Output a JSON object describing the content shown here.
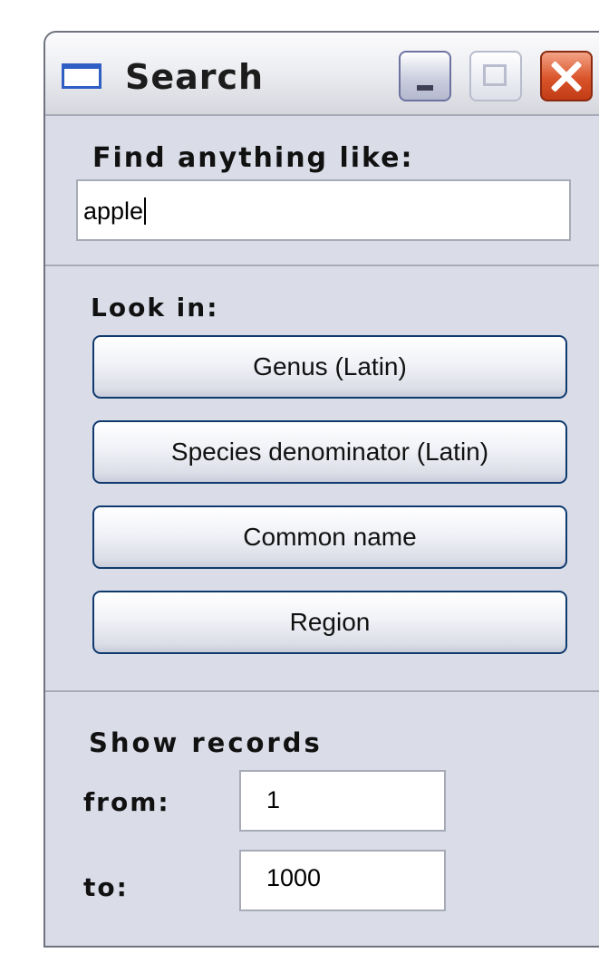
{
  "window": {
    "title": "Search",
    "icon": "window-icon",
    "controls": [
      "minimize-icon",
      "maximize-icon",
      "close-icon"
    ]
  },
  "find": {
    "label": "Find anything like:",
    "value": "apple"
  },
  "look_in": {
    "label": "Look in:",
    "buttons": [
      {
        "label": "Genus (Latin)"
      },
      {
        "label": "Species denominator (Latin)"
      },
      {
        "label": "Common name"
      },
      {
        "label": "Region"
      }
    ]
  },
  "records": {
    "label": "Show records",
    "from_label": "from:",
    "from_value": "1",
    "to_label": "to:",
    "to_value": "1000"
  },
  "colors": {
    "window_bg": "#dadde8",
    "button_border": "#0f3a6e",
    "close_red": "#d9542a",
    "icon_blue": "#2f5ec4"
  }
}
